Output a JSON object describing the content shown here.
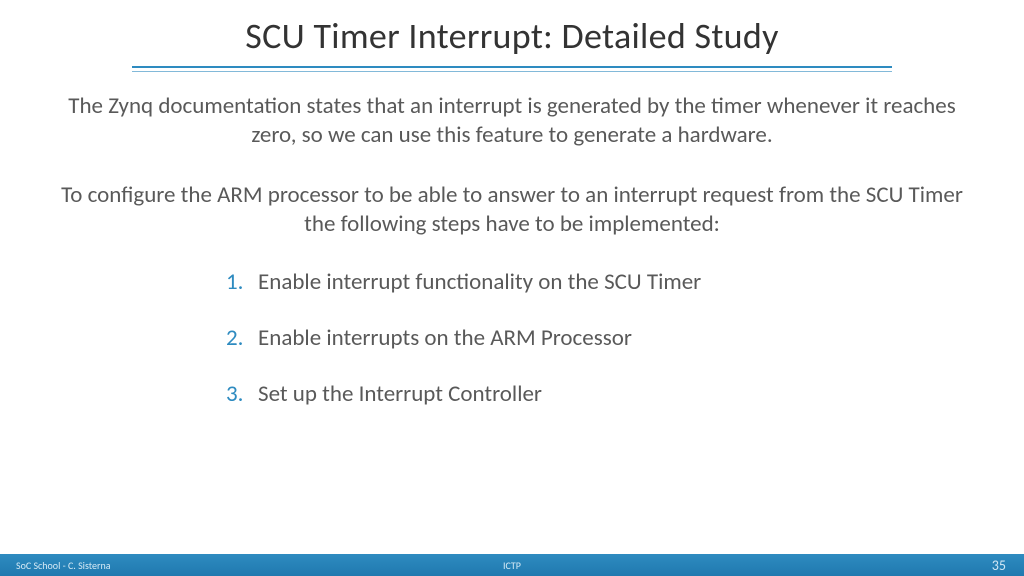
{
  "title": "SCU Timer Interrupt: Detailed Study",
  "para1": "The Zynq documentation states that an interrupt is generated by the timer whenever it reaches zero, so we can use this feature to generate a hardware.",
  "para2": "To configure the ARM processor to be able to answer to an interrupt request from the SCU Timer the following steps have to be implemented:",
  "steps": [
    {
      "num": "1.",
      "text": "Enable interrupt functionality on the SCU Timer"
    },
    {
      "num": "2.",
      "text": "Enable interrupts on the ARM Processor"
    },
    {
      "num": "3.",
      "text": "Set up the Interrupt Controller"
    }
  ],
  "footer": {
    "left": "SoC School - C. Sisterna",
    "center": "ICTP",
    "right": "35"
  }
}
